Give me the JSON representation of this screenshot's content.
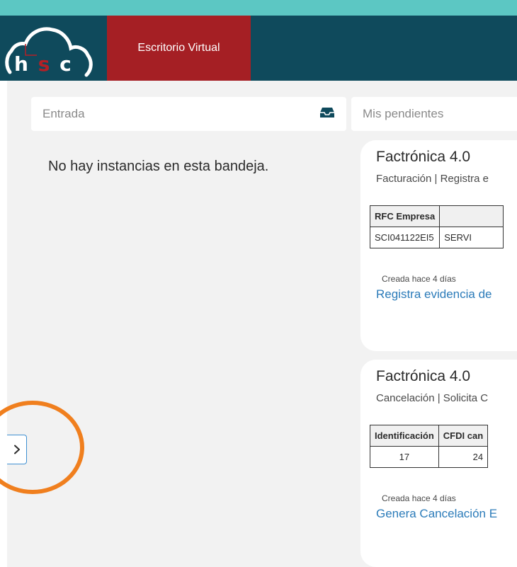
{
  "header": {
    "logo": {
      "letters": [
        "h",
        "s",
        "c"
      ]
    },
    "app_title": "Escritorio Virtual",
    "colors": {
      "accent_stripe": "#5cc7c3",
      "header_bg": "#0f4a5c",
      "tab_bg": "#a51f24",
      "logo_s": "#b42026"
    }
  },
  "search": {
    "entrada_label": "Entrada",
    "entrada_icon": "inbox-icon",
    "pendientes_label": "Mis pendientes"
  },
  "empty_message": "No hay instancias en esta bandeja.",
  "tasks": [
    {
      "title": "Factrónica 4.0",
      "subtitle": "Facturación | Registra e",
      "table": {
        "headers": [
          "RFC Empresa",
          ""
        ],
        "row": [
          "SCI041122EI5",
          "SERVI"
        ]
      },
      "created": "Creada hace 4 días",
      "action": "Registra evidencia de"
    },
    {
      "title": "Factrónica 4.0",
      "subtitle": "Cancelación | Solicita C",
      "table": {
        "headers": [
          "Identificación",
          "CFDI can"
        ],
        "row": [
          "17",
          "24"
        ]
      },
      "created": "Creada hace 4 días",
      "action": "Genera Cancelación E"
    }
  ],
  "sidebar_toggle": {
    "icon": "chevron-right-icon"
  },
  "annotation": {
    "color": "#f07f1e"
  }
}
